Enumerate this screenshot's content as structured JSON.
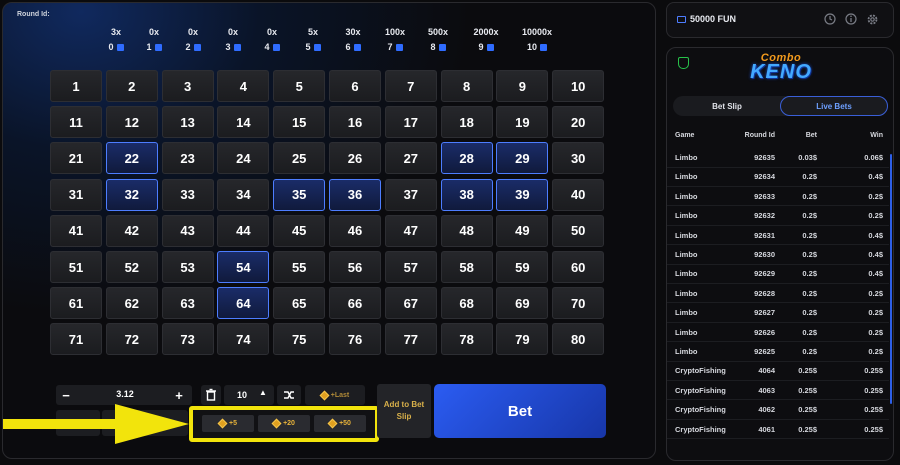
{
  "game": {
    "round_label": "Round Id:",
    "paytable": [
      {
        "mult": "3x",
        "hits": "0"
      },
      {
        "mult": "0x",
        "hits": "1"
      },
      {
        "mult": "0x",
        "hits": "2"
      },
      {
        "mult": "0x",
        "hits": "3"
      },
      {
        "mult": "0x",
        "hits": "4"
      },
      {
        "mult": "5x",
        "hits": "5"
      },
      {
        "mult": "30x",
        "hits": "6"
      },
      {
        "mult": "100x",
        "hits": "7"
      },
      {
        "mult": "500x",
        "hits": "8"
      },
      {
        "mult": "2000x",
        "hits": "9"
      },
      {
        "mult": "10000x",
        "hits": "10"
      }
    ],
    "numbers": [
      "1",
      "2",
      "3",
      "4",
      "5",
      "6",
      "7",
      "8",
      "9",
      "10",
      "11",
      "12",
      "13",
      "14",
      "15",
      "16",
      "17",
      "18",
      "19",
      "20",
      "21",
      "22",
      "23",
      "24",
      "25",
      "26",
      "27",
      "28",
      "29",
      "30",
      "31",
      "32",
      "33",
      "34",
      "35",
      "36",
      "37",
      "38",
      "39",
      "40",
      "41",
      "42",
      "43",
      "44",
      "45",
      "46",
      "47",
      "48",
      "49",
      "50",
      "51",
      "52",
      "53",
      "54",
      "55",
      "56",
      "57",
      "58",
      "59",
      "60",
      "61",
      "62",
      "63",
      "64",
      "65",
      "66",
      "67",
      "68",
      "69",
      "70",
      "71",
      "72",
      "73",
      "74",
      "75",
      "76",
      "77",
      "78",
      "79",
      "80"
    ],
    "selected": [
      22,
      28,
      29,
      32,
      35,
      36,
      38,
      39,
      54,
      64
    ]
  },
  "controls": {
    "minus": "−",
    "amount": "3.12",
    "plus": "+",
    "pick_count": "10",
    "last_label": "+Last",
    "quick_add": [
      "+5",
      "+20",
      "+50"
    ],
    "add_slip": "Add to Bet Slip",
    "bet": "Bet"
  },
  "wallet": {
    "balance": "50000 FUN"
  },
  "side": {
    "logo_top": "Combo",
    "logo_main": "KENO",
    "tabs": [
      "Bet Slip",
      "Live Bets"
    ],
    "active_tab": "Live Bets",
    "headers": {
      "game": "Game",
      "round": "Round Id",
      "bet": "Bet",
      "win": "Win"
    },
    "rows": [
      {
        "game": "Limbo",
        "round": "92635",
        "bet": "0.03$",
        "win": "0.06$"
      },
      {
        "game": "Limbo",
        "round": "92634",
        "bet": "0.2$",
        "win": "0.4$"
      },
      {
        "game": "Limbo",
        "round": "92633",
        "bet": "0.2$",
        "win": "0.2$"
      },
      {
        "game": "Limbo",
        "round": "92632",
        "bet": "0.2$",
        "win": "0.2$"
      },
      {
        "game": "Limbo",
        "round": "92631",
        "bet": "0.2$",
        "win": "0.4$"
      },
      {
        "game": "Limbo",
        "round": "92630",
        "bet": "0.2$",
        "win": "0.4$"
      },
      {
        "game": "Limbo",
        "round": "92629",
        "bet": "0.2$",
        "win": "0.4$"
      },
      {
        "game": "Limbo",
        "round": "92628",
        "bet": "0.2$",
        "win": "0.2$"
      },
      {
        "game": "Limbo",
        "round": "92627",
        "bet": "0.2$",
        "win": "0.2$"
      },
      {
        "game": "Limbo",
        "round": "92626",
        "bet": "0.2$",
        "win": "0.2$"
      },
      {
        "game": "Limbo",
        "round": "92625",
        "bet": "0.2$",
        "win": "0.2$"
      },
      {
        "game": "CryptoFishing",
        "round": "4064",
        "bet": "0.25$",
        "win": "0.25$"
      },
      {
        "game": "CryptoFishing",
        "round": "4063",
        "bet": "0.25$",
        "win": "0.25$"
      },
      {
        "game": "CryptoFishing",
        "round": "4062",
        "bet": "0.25$",
        "win": "0.25$"
      },
      {
        "game": "CryptoFishing",
        "round": "4061",
        "bet": "0.25$",
        "win": "0.25$"
      }
    ]
  },
  "colors": {
    "accent": "#2f6cff",
    "selected_border": "#4d7dff",
    "annotation": "#f2e40c",
    "chip": "#e0a020"
  }
}
